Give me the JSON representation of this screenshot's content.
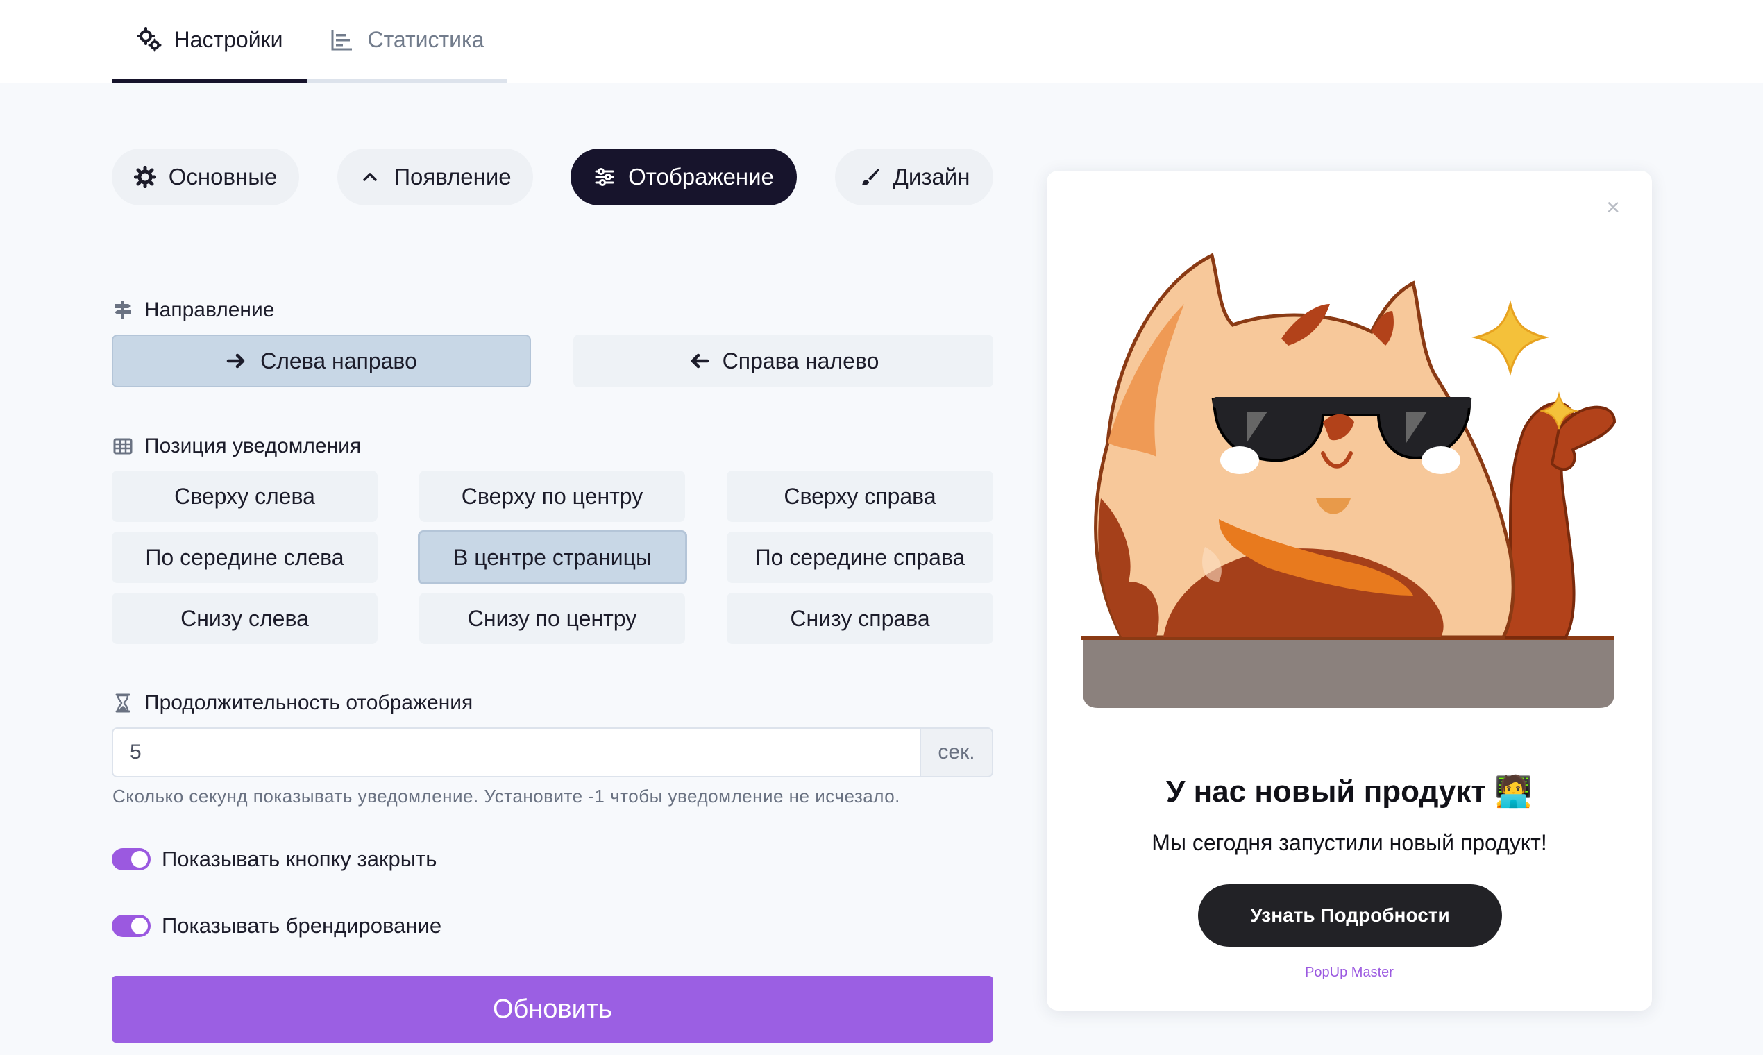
{
  "tabs": {
    "settings": "Настройки",
    "stats": "Статистика"
  },
  "subtabs": {
    "basic": "Основные",
    "appearance": "Появление",
    "display": "Отображение",
    "design": "Дизайн"
  },
  "direction": {
    "label": "Направление",
    "ltr": "Слева направо",
    "rtl": "Справа налево",
    "selected": "ltr"
  },
  "position": {
    "label": "Позиция уведомления",
    "options": [
      "Сверху слева",
      "Сверху по центру",
      "Сверху справа",
      "По середине слева",
      "В центре страницы",
      "По середине справа",
      "Снизу слева",
      "Снизу по центру",
      "Снизу справа"
    ],
    "selected_index": 4
  },
  "duration": {
    "label": "Продолжительность отображения",
    "value": "5",
    "suffix": "сек.",
    "hint": "Сколько секунд показывать уведомление. Установите -1 чтобы уведомление не исчезало."
  },
  "toggles": {
    "close_button": "Показывать кнопку закрыть",
    "branding": "Показывать брендирование"
  },
  "update_button": "Обновить",
  "preview": {
    "close": "×",
    "title": "У нас новый продукт 🧑‍💻",
    "text": "Мы сегодня запустили новый продукт!",
    "button": "Узнать Подробности",
    "brand": "PopUp Master"
  },
  "colors": {
    "accent": "#9b5fe3",
    "dark": "#17142c",
    "selected_button": "#c8d7e6"
  }
}
